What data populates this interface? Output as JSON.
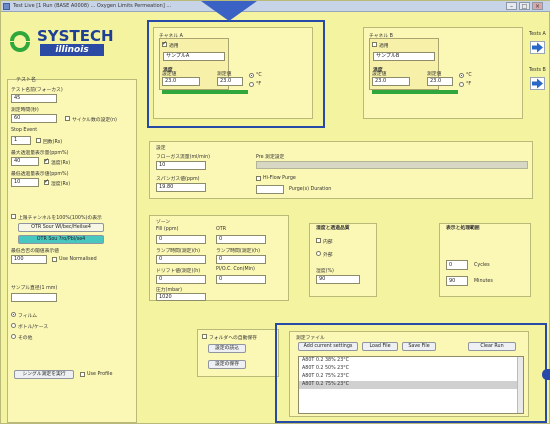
{
  "window": {
    "title": "Test Live [1 Run (BASE A0008) ... Oxygen Limits Permeation] ...",
    "min_glyph": "–",
    "max_glyph": "□",
    "close_glyph": "×"
  },
  "logo": {
    "brand": "SYSTECH",
    "sub": "illinois"
  },
  "left": {
    "group_title": "テスト名",
    "test_name_label": "テスト名前(フォーカス)",
    "test_name_value": "45",
    "cycle_time_label": "測定時間(秒)",
    "cycle_time_value": "60",
    "temp_check_label": "サイクル数の設定(n)",
    "stop_label": "Stop Event",
    "stop_value": "1",
    "stop_check_label": "回数(Rs)",
    "s1_label": "最大透過量表示量(ppm%)",
    "s1_value": "40",
    "s1_check_label": "温度(Rs)",
    "s2_label": "最低透過量表示値(ppm%)",
    "s2_value": "10",
    "s2_check_label": "湿度(Rs)",
    "auto_label": "上限チャンネルを100%(100%)の表示",
    "btn_a": "OTR Sour Wl/bec/Heilse4",
    "btn_b": "OTR Sou ?ro/Pbl/se4",
    "dc_label": "最低合否の閾値表示値",
    "dc_value": "100",
    "dc_check_label": "Use Normalised",
    "sample_label": "サンプル直径(1 mm)",
    "r1": "フィルム",
    "r2": "ボトル/ケース",
    "r3": "その他",
    "bottom_btn": "シングル測定を実行",
    "bottom_check": "Use Profile"
  },
  "panel_a": {
    "title": "チャネル A",
    "sample_check": "適用",
    "sample_value": "サンプルA",
    "temp_label": "温度",
    "set_label": "設定値",
    "meas_label": "測定値",
    "temp_set": "23.0",
    "temp_meas": "23.0",
    "unit_c": "°C",
    "unit_f": "°F"
  },
  "panel_b": {
    "title": "チャネル B",
    "sample_check": "適用",
    "sample_value": "サンプルB",
    "temp_label": "温度",
    "set_label": "設定値",
    "meas_label": "測定値",
    "temp_set": "23.0",
    "temp_meas": "23.0",
    "unit_c": "°C",
    "unit_f": "°F"
  },
  "tests": {
    "a": "Tests A",
    "b": "Tests B"
  },
  "mid": {
    "title": "設定",
    "flow_label": "フローガス流量(ml/min)",
    "flow_value": "10",
    "span_label": "スパンガス値(ppm)",
    "span_value": "19.80",
    "cal_label": "Pre 測定設定",
    "purge_label": "Hi-Flow Purge",
    "purge_dur_label": "Purge(s) Duration"
  },
  "lower": {
    "title": "ゾーン",
    "fill_label": "Fill (ppm)",
    "fill_value": "0",
    "otr_label": "OTR",
    "otr_value": "0",
    "c1_label": "ランプ時間(測定)(h)",
    "c1_value": "0",
    "c2_label": "ランプ時間(測定)(h)",
    "c2_value": "0",
    "d1_label": "ドリフト値(測定)(h)",
    "d1_value": "0",
    "d2_label": "Pl/O.C. Con(Min)",
    "d2_value": "0",
    "bar_label": "圧力(mbar)",
    "bar_value": "1020"
  },
  "hum": {
    "title": "湿度と透過品質",
    "r1": "内部",
    "r2": "外部",
    "gas_label": "湿度(%)",
    "gas_value": "90"
  },
  "cycles": {
    "title": "表示と処理範囲",
    "cycles_value": "0",
    "cycles_label": "Cycles",
    "minutes_value": "90",
    "minutes_label": "Minutes"
  },
  "files": {
    "check_label": "フォルダへの自動保存",
    "btn_load": "設定の読込",
    "btn_save": "設定の保存"
  },
  "profile": {
    "title": "測定ファイル",
    "btn_add": "Add current settings",
    "btn_load": "Load File",
    "btn_save": "Save File",
    "btn_clear": "Clear Run",
    "rows": [
      "A80T 0.2 38% 23°C",
      "A80T 0.2  50%  23°C",
      "A80T 0.2 75% 23°C",
      "A80T 0.2 75% 23°C"
    ]
  },
  "colors": {
    "accent": "#2749a8",
    "panel": "#fbf7b4",
    "active": "#2fa73c"
  }
}
